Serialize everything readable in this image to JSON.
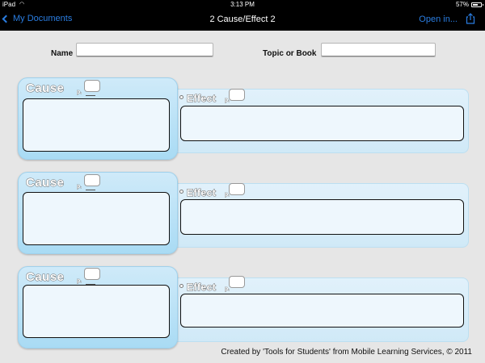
{
  "status_bar": {
    "device": "iPad",
    "time": "3:13 PM",
    "battery_percent": "57%"
  },
  "nav_bar": {
    "back_label": "My Documents",
    "title": "2 Cause/Effect 2",
    "open_in_label": "Open in..."
  },
  "form": {
    "name_label": "Name",
    "topic_label": "Topic or Book",
    "name_value": "",
    "topic_value": ""
  },
  "rows": [
    {
      "cause_label": "Cause",
      "effect_label": "Effect",
      "page_label": "p."
    },
    {
      "cause_label": "Cause",
      "effect_label": "Effect",
      "page_label": "p."
    },
    {
      "cause_label": "Cause",
      "effect_label": "Effect",
      "page_label": "p."
    }
  ],
  "footer": {
    "credit": "Created by 'Tools for Students' from Mobile Learning Services, © 2011"
  },
  "colors": {
    "ios_blue": "#2a7de1",
    "cause_fill": "#a9dbf4",
    "effect_fill": "#d0e9f7",
    "page_background": "#e6e6e6"
  }
}
